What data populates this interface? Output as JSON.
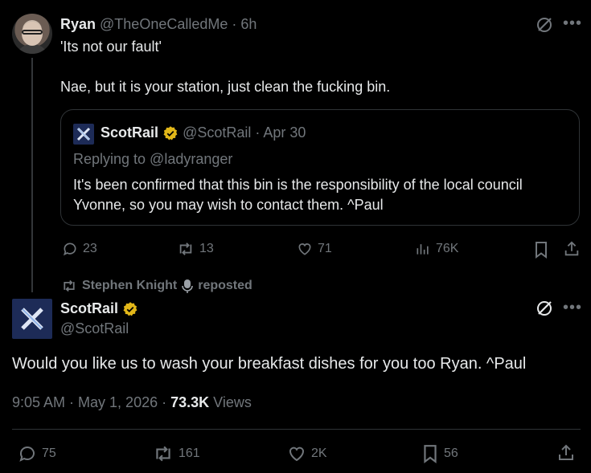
{
  "reply": {
    "author_name": "Ryan",
    "author_handle": "@TheOneCalledMe",
    "time": "· 6h",
    "text_line1": "'Its not our fault'",
    "text_line2": "Nae, but it is your station, just clean the fucking bin.",
    "quote": {
      "author_name": "ScotRail",
      "author_handle": "@ScotRail",
      "time": "· Apr 30",
      "replying_to": "Replying to @ladyranger",
      "text": "It's been confirmed that this bin is the responsibility of the local council Yvonne, so you may wish to contact them. ^Paul"
    },
    "actions": {
      "replies": "23",
      "reposts": "13",
      "likes": "71",
      "views": "76K"
    }
  },
  "repost_banner": {
    "name": "Stephen Knight",
    "label": "reposted"
  },
  "main": {
    "author_name": "ScotRail",
    "author_handle": "@ScotRail",
    "text": "Would you like us to wash your breakfast dishes for you too Ryan. ^Paul",
    "timestamp": "9:05 AM · May 1, 2026 ·",
    "views_count": "73.3K",
    "views_label": "Views",
    "actions": {
      "replies": "75",
      "reposts": "161",
      "likes": "2K",
      "bookmarks": "56"
    }
  },
  "colors": {
    "background": "#000000",
    "text": "#e7e9ea",
    "muted": "#71767b",
    "verified_gold": "#e2b719",
    "scotrail_navy": "#1d2b57"
  }
}
